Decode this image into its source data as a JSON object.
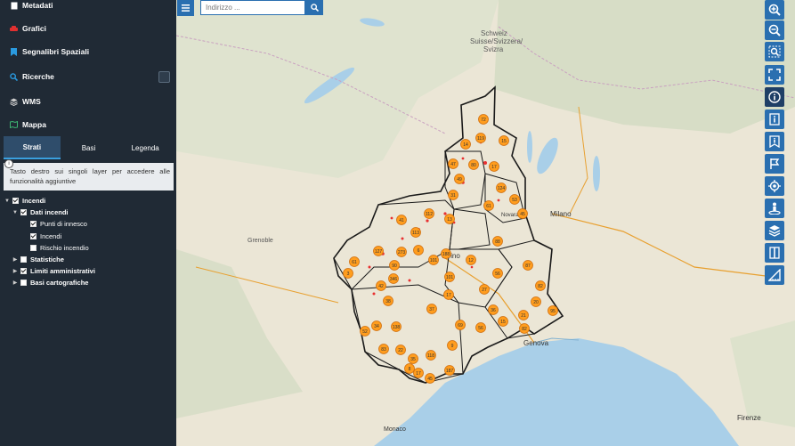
{
  "sidebar": {
    "items": [
      {
        "label": "Metadati",
        "icon": "document-icon"
      },
      {
        "label": "Grafici",
        "icon": "car-icon"
      },
      {
        "label": "Segnalibri Spaziali",
        "icon": "bookmark-icon"
      },
      {
        "label": "Ricerche",
        "icon": "search-icon"
      },
      {
        "label": "WMS",
        "icon": "layers-icon"
      },
      {
        "label": "Mappa",
        "icon": "map-icon"
      }
    ],
    "calculator_icon": "calculator-icon",
    "tabs": [
      "Strati",
      "Basi",
      "Legenda"
    ],
    "active_tab": "Strati",
    "info_text": "Tasto destro sui singoli layer per accedere alle funzionalità aggiuntive",
    "tree": {
      "incendi": "Incendi",
      "dati_incendi": "Dati incendi",
      "punti": "Punti di innesco",
      "incendi_layer": "Incendi",
      "rischio": "Rischio incendio",
      "statistiche": "Statistiche",
      "limiti": "Limiti amministrativi",
      "basi": "Basi cartografiche"
    }
  },
  "search": {
    "placeholder": "Indirizzo ..."
  },
  "map": {
    "labels": {
      "schweiz": "Schweiz",
      "suisse": "Suisse/Svizzera/",
      "svizra": "Svizra",
      "milano": "Milano",
      "torino": "Torino",
      "genova": "Genova",
      "novara": "Novara",
      "monaco": "Monaco",
      "grenoble": "Grenoble",
      "firenze": "Firenze"
    },
    "clusters": [
      "72",
      "14",
      "119",
      "15",
      "47",
      "80",
      "49",
      "17",
      "124",
      "53",
      "31",
      "112",
      "41",
      "13",
      "61",
      "45",
      "113",
      "88",
      "6",
      "101",
      "273",
      "127",
      "188",
      "12",
      "87",
      "61",
      "3",
      "90",
      "346",
      "42",
      "56",
      "101",
      "27",
      "82",
      "17",
      "20",
      "38",
      "37",
      "95",
      "36",
      "21",
      "15",
      "69",
      "56",
      "138",
      "34",
      "82",
      "52",
      "9",
      "83",
      "22",
      "118",
      "35",
      "187",
      "45",
      "17",
      "8"
    ],
    "colors": {
      "cluster": "#ff9d1e",
      "boundary": "#1a1a1a",
      "fire": "#e83030",
      "sea": "#a9cfe8"
    }
  },
  "toolbar": {
    "icons": [
      "zoom-in-icon",
      "zoom-out-icon",
      "zoom-box-icon",
      "fullscreen-icon",
      "info-icon",
      "identify-icon",
      "bookmark-tool-icon",
      "flag-icon",
      "locate-icon",
      "streetview-icon",
      "layers-tool-icon",
      "split-icon",
      "measure-icon"
    ]
  }
}
